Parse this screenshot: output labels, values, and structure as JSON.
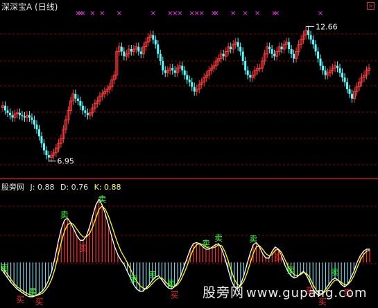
{
  "window": {
    "title": "深深宝A (日线)"
  },
  "price_panel": {
    "high_label": "12.66",
    "low_label": "6.95",
    "signal_marker": "×"
  },
  "indicator_panel": {
    "name": "股旁网",
    "j_label": "J: 0.88",
    "d_label": "D: 0.76",
    "k_label": "K: 0.88",
    "buy_text": "买",
    "sell_text": "卖"
  },
  "watermark": {
    "cn": "股旁网",
    "url": "www.gupang.com"
  },
  "colors": {
    "background": "#000000",
    "grid": "#8b0000",
    "up_candle": "#ff3c3c",
    "down_candle": "#54ffff",
    "signal_magenta": "#ff33ff",
    "k_line": "#ffffff",
    "d_line": "#ffff00",
    "buy": "#ff3030",
    "sell": "#33ff33"
  },
  "chart_data": [
    {
      "type": "candlestick",
      "title": "深深宝A (日线)",
      "ylim": [
        6.5,
        13.2
      ],
      "annotations": [
        {
          "label": "12.66",
          "value": 12.66,
          "kind": "high"
        },
        {
          "label": "6.95",
          "value": 6.95,
          "kind": "low"
        }
      ],
      "close": [
        9.3,
        9.1,
        9.0,
        8.9,
        8.8,
        8.95,
        9.0,
        8.9,
        8.85,
        8.8,
        8.9,
        8.8,
        8.7,
        8.5,
        8.3,
        8.0,
        7.7,
        7.4,
        7.2,
        7.1,
        7.2,
        7.3,
        7.5,
        7.7,
        7.9,
        8.3,
        8.7,
        9.1,
        9.5,
        9.8,
        9.6,
        9.5,
        9.3,
        9.1,
        9.0,
        8.9,
        9.0,
        9.2,
        9.4,
        9.5,
        9.7,
        9.8,
        9.9,
        10.0,
        10.1,
        10.4,
        10.6,
        11.6,
        11.8,
        11.6,
        11.4,
        11.5,
        11.7,
        11.6,
        11.7,
        11.8,
        11.6,
        11.5,
        11.8,
        12.0,
        12.2,
        12.3,
        12.1,
        11.9,
        11.5,
        11.2,
        10.8,
        10.7,
        10.8,
        10.9,
        10.8,
        10.7,
        10.9,
        11.0,
        10.8,
        10.6,
        10.4,
        10.3,
        10.1,
        9.9,
        10.0,
        10.2,
        10.3,
        10.5,
        10.6,
        10.8,
        10.9,
        11.0,
        11.2,
        11.3,
        11.5,
        11.4,
        11.6,
        11.8,
        11.7,
        11.9,
        12.0,
        11.8,
        11.6,
        11.2,
        10.8,
        10.6,
        10.5,
        10.6,
        10.8,
        10.9,
        10.9,
        11.2,
        11.5,
        11.8,
        11.7,
        11.5,
        11.4,
        11.6,
        11.8,
        11.7,
        11.9,
        12.0,
        11.7,
        11.5,
        11.3,
        11.6,
        11.9,
        12.1,
        12.3,
        12.5,
        12.3,
        12.1,
        11.9,
        11.6,
        11.3,
        11.0,
        10.8,
        10.6,
        10.7,
        10.8,
        10.9,
        11.0,
        10.9,
        10.7,
        10.5,
        10.3,
        10.0,
        9.8,
        9.6,
        9.9,
        10.1,
        10.3,
        10.5,
        10.6,
        10.8,
        10.9
      ],
      "signal_indices": [
        31,
        32,
        33,
        37,
        41,
        48,
        62,
        69,
        71,
        73,
        78,
        80,
        82,
        87,
        88,
        95,
        100,
        105,
        112,
        113,
        131
      ]
    },
    {
      "type": "line",
      "series": [
        {
          "name": "K",
          "values": [
            0.32,
            0.28,
            0.24,
            0.2,
            0.17,
            0.14,
            0.12,
            0.1,
            0.08,
            0.07,
            0.07,
            0.08,
            0.1,
            0.12,
            0.16,
            0.22,
            0.3,
            0.42,
            0.56,
            0.68,
            0.76,
            0.78,
            0.74,
            0.68,
            0.62,
            0.58,
            0.58,
            0.62,
            0.7,
            0.8,
            0.9,
            0.95,
            0.9,
            0.82,
            0.72,
            0.62,
            0.52,
            0.45,
            0.4,
            0.36,
            0.3,
            0.24,
            0.18,
            0.14,
            0.12,
            0.12,
            0.15,
            0.18,
            0.22,
            0.25,
            0.26,
            0.22,
            0.18,
            0.15,
            0.14,
            0.16,
            0.2,
            0.26,
            0.34,
            0.42,
            0.5,
            0.55,
            0.56,
            0.55,
            0.52,
            0.5,
            0.5,
            0.52,
            0.54,
            0.55,
            0.5,
            0.42,
            0.32,
            0.22,
            0.16,
            0.14,
            0.18,
            0.26,
            0.36,
            0.46,
            0.54,
            0.56,
            0.52,
            0.46,
            0.42,
            0.42,
            0.48,
            0.52,
            0.5,
            0.44,
            0.36,
            0.3,
            0.26,
            0.24,
            0.25,
            0.28,
            0.3,
            0.26,
            0.2,
            0.14,
            0.1,
            0.08,
            0.1,
            0.14,
            0.18,
            0.22,
            0.24,
            0.22,
            0.18,
            0.16,
            0.18,
            0.24,
            0.3,
            0.38,
            0.44,
            0.48,
            0.5,
            0.5
          ]
        },
        {
          "name": "D",
          "values": [
            0.34,
            0.31,
            0.27,
            0.23,
            0.19,
            0.16,
            0.14,
            0.12,
            0.1,
            0.09,
            0.08,
            0.08,
            0.09,
            0.1,
            0.13,
            0.17,
            0.23,
            0.32,
            0.44,
            0.56,
            0.66,
            0.72,
            0.74,
            0.72,
            0.68,
            0.64,
            0.61,
            0.61,
            0.64,
            0.7,
            0.78,
            0.86,
            0.89,
            0.86,
            0.8,
            0.72,
            0.63,
            0.55,
            0.48,
            0.43,
            0.38,
            0.32,
            0.26,
            0.21,
            0.17,
            0.15,
            0.14,
            0.16,
            0.19,
            0.22,
            0.24,
            0.24,
            0.21,
            0.18,
            0.16,
            0.16,
            0.18,
            0.22,
            0.28,
            0.35,
            0.43,
            0.5,
            0.54,
            0.55,
            0.54,
            0.52,
            0.51,
            0.51,
            0.52,
            0.54,
            0.53,
            0.48,
            0.4,
            0.31,
            0.23,
            0.18,
            0.17,
            0.21,
            0.28,
            0.37,
            0.46,
            0.52,
            0.53,
            0.5,
            0.46,
            0.44,
            0.45,
            0.49,
            0.5,
            0.47,
            0.41,
            0.35,
            0.3,
            0.27,
            0.26,
            0.27,
            0.29,
            0.28,
            0.24,
            0.18,
            0.13,
            0.1,
            0.1,
            0.12,
            0.15,
            0.19,
            0.22,
            0.22,
            0.2,
            0.18,
            0.18,
            0.21,
            0.26,
            0.33,
            0.4,
            0.45,
            0.48,
            0.49
          ]
        }
      ],
      "ylim": [
        0,
        1
      ],
      "annotations": [
        {
          "text": "卖",
          "index": 1,
          "kind": "sell"
        },
        {
          "text": "买",
          "index": 6,
          "kind": "buy"
        },
        {
          "text": "卖",
          "index": 10,
          "kind": "sell"
        },
        {
          "text": "买",
          "index": 12,
          "kind": "buy"
        },
        {
          "text": "卖",
          "index": 20,
          "kind": "sell"
        },
        {
          "text": "买",
          "index": 26,
          "kind": "buy"
        },
        {
          "text": "卖",
          "index": 32,
          "kind": "sell"
        },
        {
          "text": "卖",
          "index": 42,
          "kind": "sell"
        },
        {
          "text": "卖",
          "index": 48,
          "kind": "sell"
        },
        {
          "text": "卖",
          "index": 54,
          "kind": "sell"
        },
        {
          "text": "买",
          "index": 55,
          "kind": "buy"
        },
        {
          "text": "卖",
          "index": 65,
          "kind": "sell"
        },
        {
          "text": "卖",
          "index": 69,
          "kind": "sell"
        },
        {
          "text": "卖",
          "index": 80,
          "kind": "sell"
        },
        {
          "text": "买",
          "index": 88,
          "kind": "buy"
        },
        {
          "text": "卖",
          "index": 92,
          "kind": "sell"
        },
        {
          "text": "买",
          "index": 98,
          "kind": "buy"
        },
        {
          "text": "买",
          "index": 102,
          "kind": "buy"
        },
        {
          "text": "卖",
          "index": 106,
          "kind": "sell"
        },
        {
          "text": "买",
          "index": 110,
          "kind": "buy"
        }
      ]
    }
  ]
}
